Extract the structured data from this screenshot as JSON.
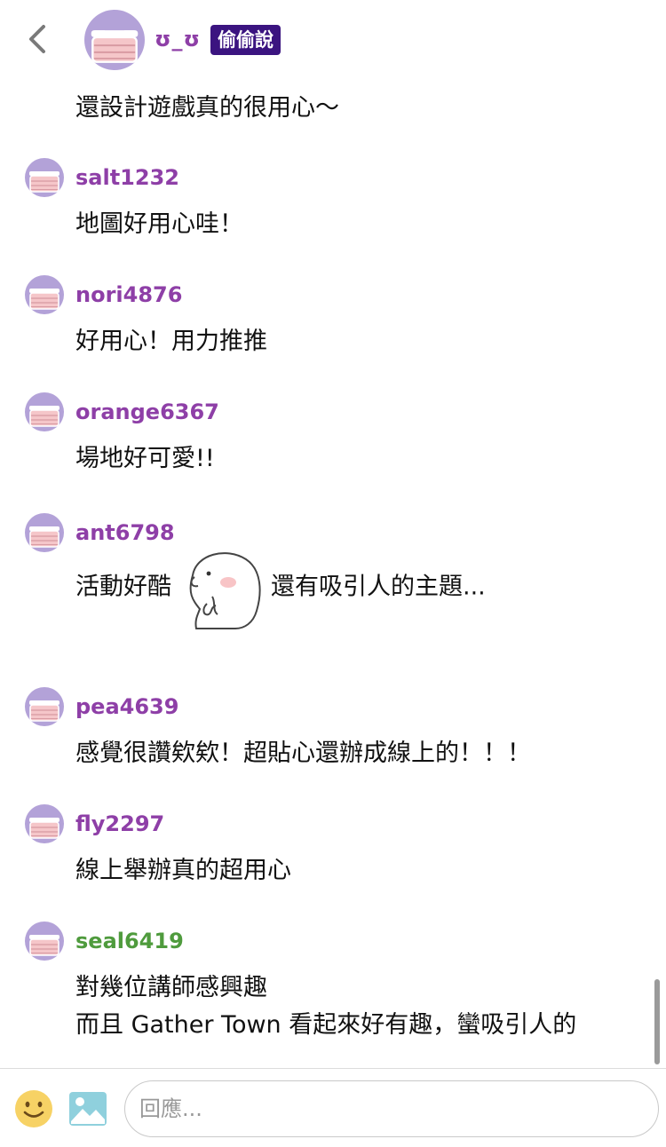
{
  "header": {
    "author": "ʊ_ʊ",
    "badge": "偷偷說",
    "back_icon": "chevron-left-icon"
  },
  "previous_comment_text": "還設計遊戲真的很用心～",
  "comments": [
    {
      "username": "salt1232",
      "text": "地圖好用心哇！"
    },
    {
      "username": "nori4876",
      "text": "好用心！用力推推"
    },
    {
      "username": "orange6367",
      "text": "場地好可愛!!"
    },
    {
      "username": "ant6798",
      "text_before_sticker": "活動好酷",
      "text_after_sticker": "還有吸引人的主題..."
    },
    {
      "username": "pea4639",
      "text": "感覺很讚欸欸！超貼心還辦成線上的！！！"
    },
    {
      "username": "fly2297",
      "text": "線上舉辦真的超用心"
    },
    {
      "username": "seal6419",
      "line1": "對幾位講師感興趣",
      "line2": "而且 Gather Town 看起來好有趣，蠻吸引人的"
    }
  ],
  "input": {
    "placeholder": "回應..."
  },
  "colors": {
    "username": "#8e3fa7",
    "username_green": "#4f9b3d",
    "badge_bg": "#3b1480",
    "avatar_bg": "#b3a2d8",
    "avatar_mask": "#f5c6c9"
  }
}
